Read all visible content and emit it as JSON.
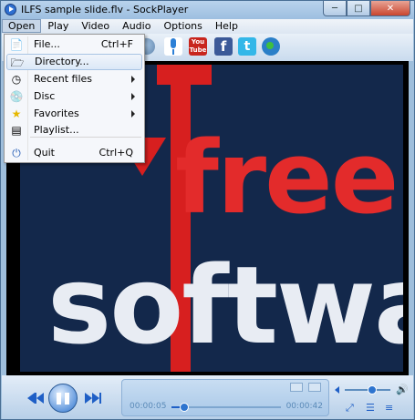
{
  "window": {
    "title": "ILFS sample slide.flv - SockPlayer"
  },
  "menubar": {
    "items": [
      {
        "label": "Open"
      },
      {
        "label": "Play"
      },
      {
        "label": "Video"
      },
      {
        "label": "Audio"
      },
      {
        "label": "Options"
      },
      {
        "label": "Help"
      }
    ]
  },
  "open_menu": {
    "items": [
      {
        "label": "File...",
        "shortcut": "Ctrl+F",
        "icon": "file-icon"
      },
      {
        "label": "Directory...",
        "shortcut": "",
        "icon": "folder-icon",
        "highlighted": true
      },
      {
        "label": "Recent files",
        "shortcut": "",
        "icon": "clock-icon",
        "submenu": true
      },
      {
        "label": "Disc",
        "shortcut": "",
        "icon": "disc-icon",
        "submenu": true
      },
      {
        "label": "Favorites",
        "shortcut": "",
        "icon": "star-icon",
        "submenu": true
      },
      {
        "label": "Playlist...",
        "shortcut": "",
        "icon": "playlist-icon"
      },
      {
        "label": "Quit",
        "shortcut": "Ctrl+Q",
        "icon": "power-icon"
      }
    ]
  },
  "toolbar": {
    "youtube_label": "You Tube",
    "facebook_label": "f",
    "twitter_label": "t"
  },
  "player": {
    "current_time": "00:00:05",
    "total_time": "00:00:42",
    "progress": 0.12,
    "volume": 0.6
  },
  "video": {
    "logo_line1": "free",
    "logo_line2": "software"
  },
  "colors": {
    "accent": "#1f5fc6",
    "video_bg": "#13284b",
    "logo_red": "#d71f1f"
  }
}
